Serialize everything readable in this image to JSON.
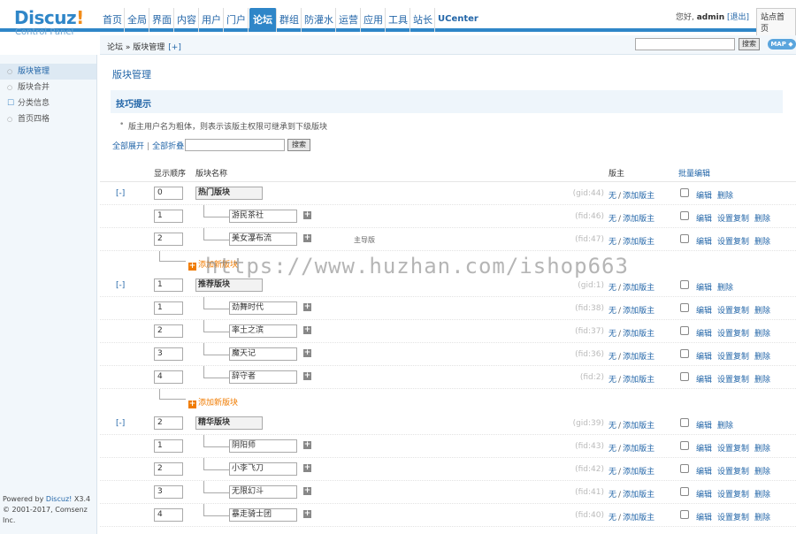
{
  "logo": {
    "brand": "Discuz",
    "excl": "!",
    "sub": "Control Panel"
  },
  "nav": [
    "首页",
    "全局",
    "界面",
    "内容",
    "用户",
    "门户",
    "论坛",
    "群组",
    "防灌水",
    "运营",
    "应用",
    "工具",
    "站长",
    "UCenter"
  ],
  "nav_active": 6,
  "user": {
    "greeting": "您好, ",
    "name": "admin",
    "logout": "[退出]",
    "site_home": "站点首页"
  },
  "breadcrumb": {
    "root": "论坛",
    "sep": " » ",
    "current": "版块管理",
    "plus": "[+]"
  },
  "top_search": {
    "button": "搜索",
    "map": "MAP ◆"
  },
  "sidebar": {
    "items": [
      {
        "label": "版块管理",
        "active": true,
        "icon": "○"
      },
      {
        "label": "版块合并",
        "active": false,
        "icon": "○"
      },
      {
        "label": "分类信息",
        "active": false,
        "icon": "☐",
        "checked": true
      },
      {
        "label": "首页四格",
        "active": false,
        "icon": "○"
      }
    ]
  },
  "powered": {
    "line1_pre": "Powered by ",
    "line1_brand": "Discuz!",
    "line1_ver": " X3.4",
    "line2": "© 2001-2017, Comsenz Inc."
  },
  "page": {
    "title": "版块管理",
    "tips_title": "技巧提示",
    "tip_dot": "•",
    "tip_text": "版主用户名为粗体，则表示该版主权限可继承到下级版块",
    "expand_all": "全部展开",
    "collapse_all": "全部折叠",
    "expand_sep": "|",
    "search_btn": "搜索"
  },
  "table": {
    "headers": {
      "order": "显示顺序",
      "name": "版块名称",
      "moderator": "版主",
      "batch": "批量编辑"
    }
  },
  "labels": {
    "none": "无",
    "slash": "/",
    "add_mod": "添加版主",
    "edit": "编辑",
    "copy": "设置复制",
    "del": "删除",
    "add_forum": "添加新版块",
    "plus": "+",
    "collapse": "[-]"
  },
  "groups": [
    {
      "order": "0",
      "name": "热门版块",
      "gid": "(gid:44)",
      "forums": [
        {
          "order": "1",
          "name": "游民茶社",
          "fid": "(fid:46)",
          "note": ""
        },
        {
          "order": "2",
          "name": "美女瀑布流",
          "fid": "(fid:47)",
          "note": "主导版"
        }
      ]
    },
    {
      "order": "1",
      "name": "推荐版块",
      "gid": "(gid:1)",
      "forums": [
        {
          "order": "1",
          "name": "劲舞时代",
          "fid": "(fid:38)",
          "note": ""
        },
        {
          "order": "2",
          "name": "率土之滨",
          "fid": "(fid:37)",
          "note": ""
        },
        {
          "order": "3",
          "name": "魔天记",
          "fid": "(fid:36)",
          "note": ""
        },
        {
          "order": "4",
          "name": "辞守者",
          "fid": "(fid:2)",
          "note": ""
        }
      ]
    },
    {
      "order": "2",
      "name": "精华版块",
      "gid": "(gid:39)",
      "forums": [
        {
          "order": "1",
          "name": "阴阳师",
          "fid": "(fid:43)",
          "note": ""
        },
        {
          "order": "2",
          "name": "小李飞刀",
          "fid": "(fid:42)",
          "note": ""
        },
        {
          "order": "3",
          "name": "无限幻斗",
          "fid": "(fid:41)",
          "note": ""
        },
        {
          "order": "4",
          "name": "暴走骑士团",
          "fid": "(fid:40)",
          "note": ""
        }
      ]
    }
  ],
  "watermark": "https://www.huzhan.com/ishop663"
}
